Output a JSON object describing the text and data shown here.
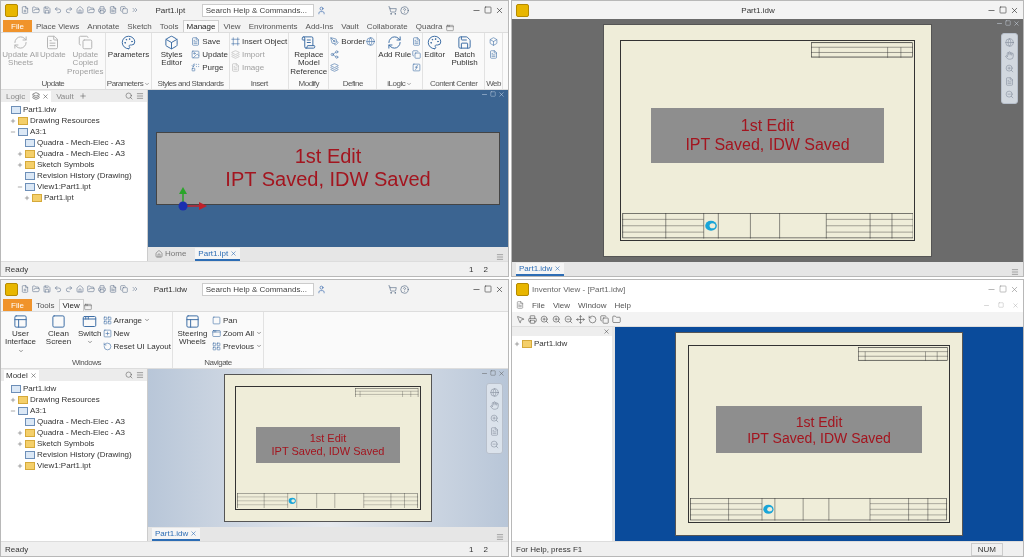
{
  "panes": [
    {
      "kind": "inventor",
      "title": "Part1.ipt",
      "search": {
        "placeholder": "Search Help & Commands..."
      },
      "ribbon_tabs": [
        {
          "label": "File",
          "selected": false
        },
        {
          "label": "Place Views",
          "selected": false
        },
        {
          "label": "Annotate",
          "selected": false
        },
        {
          "label": "Sketch",
          "selected": false
        },
        {
          "label": "Tools",
          "selected": false
        },
        {
          "label": "Manage",
          "selected": true
        },
        {
          "label": "View",
          "selected": false
        },
        {
          "label": "Environments",
          "selected": false
        },
        {
          "label": "Add-Ins",
          "selected": false
        },
        {
          "label": "Vault",
          "selected": false
        },
        {
          "label": "Collaborate",
          "selected": false
        },
        {
          "label": "Quadra",
          "selected": false
        }
      ],
      "panels": [
        {
          "title": "Update",
          "dropdown": false,
          "tools": [
            {
              "kind": "large",
              "label": "Update All Sheets",
              "disabled": true
            },
            {
              "kind": "large",
              "label": "Update",
              "disabled": true
            },
            {
              "kind": "large",
              "label": "Update Copied Properties",
              "disabled": true
            }
          ]
        },
        {
          "title": "Parameters",
          "dropdown": true,
          "tools": [
            {
              "kind": "large",
              "label": "Parameters",
              "disabled": false
            }
          ]
        },
        {
          "title": "Styles and Standards",
          "dropdown": false,
          "tools": [
            {
              "kind": "large",
              "label": "Styles Editor",
              "disabled": false
            },
            {
              "kind": "small",
              "label": "Save",
              "disabled": false
            },
            {
              "kind": "small",
              "label": "Update",
              "disabled": false
            },
            {
              "kind": "small",
              "label": "Purge",
              "disabled": false
            }
          ]
        },
        {
          "title": "Insert",
          "dropdown": false,
          "tools": [
            {
              "kind": "small",
              "label": "Insert Object",
              "disabled": false
            },
            {
              "kind": "small",
              "label": "Import",
              "disabled": true
            },
            {
              "kind": "small",
              "label": "Image",
              "disabled": true
            }
          ]
        },
        {
          "title": "Modify",
          "dropdown": false,
          "tools": [
            {
              "kind": "large",
              "label": "Replace Model Reference",
              "disabled": false
            }
          ]
        },
        {
          "title": "Define",
          "dropdown": false,
          "tools": [
            {
              "kind": "small",
              "label": "Border",
              "disabled": false
            },
            {
              "kind": "icon",
              "disabled": false
            },
            {
              "kind": "icon",
              "disabled": false
            },
            {
              "kind": "icon",
              "disabled": false
            }
          ]
        },
        {
          "title": "iLogic",
          "dropdown": true,
          "tools": [
            {
              "kind": "large",
              "label": "Add Rule",
              "disabled": false
            },
            {
              "kind": "icon",
              "disabled": false
            },
            {
              "kind": "icon",
              "disabled": false
            },
            {
              "kind": "icon",
              "disabled": false
            }
          ]
        },
        {
          "title": "Content Center",
          "dropdown": false,
          "tools": [
            {
              "kind": "large",
              "label": "Editor",
              "disabled": false
            },
            {
              "kind": "large",
              "label": "Batch Publish",
              "disabled": false
            }
          ]
        },
        {
          "title": "Web",
          "dropdown": false,
          "tools": [
            {
              "kind": "icon",
              "disabled": false
            },
            {
              "kind": "icon",
              "disabled": false
            }
          ]
        }
      ],
      "browser": {
        "tabs": [
          {
            "label": "Logic",
            "selected": false,
            "closable": false
          },
          {
            "selected": true,
            "closable": true
          },
          {
            "label": "Vault",
            "selected": false,
            "closable": false
          }
        ],
        "tree": [
          {
            "label": "Part1.idw",
            "children": [
              {
                "label": "Drawing Resources",
                "expanded": false
              },
              {
                "label": "A3:1",
                "expanded": true,
                "children": [
                  {
                    "label": "Quadra - Mech-Elec - A3"
                  },
                  {
                    "label": "Quadra - Mech-Elec - A3",
                    "expanded": false
                  },
                  {
                    "label": "Sketch Symbols",
                    "expanded": false
                  },
                  {
                    "label": "Revision History (Drawing)"
                  },
                  {
                    "label": "View1:Part1.ipt",
                    "expanded": true,
                    "children": [
                      {
                        "label": "Part1.ipt",
                        "expanded": false
                      }
                    ]
                  }
                ]
              }
            ]
          }
        ]
      },
      "viewport": {
        "kind": "model",
        "note": [
          "1st Edit",
          "IPT Saved, IDW Saved"
        ]
      },
      "doc_tabs": [
        {
          "label": "Home",
          "selected": false
        },
        {
          "label": "Part1.ipt",
          "selected": true
        }
      ],
      "status_bar": {
        "text": "Ready",
        "pages": [
          "1",
          "2"
        ]
      }
    },
    {
      "kind": "drawing_window",
      "title": "Part1.idw",
      "viewport": {
        "kind": "dark",
        "note": [
          "1st Edit",
          "IPT Saved, IDW Saved"
        ]
      },
      "doc_tabs": [
        {
          "label": "Part1.idw",
          "selected": true
        }
      ]
    },
    {
      "kind": "inventor",
      "title": "Part1.idw",
      "search": {
        "placeholder": "Search Help & Commands..."
      },
      "ribbon_tabs": [
        {
          "label": "File",
          "selected": false
        },
        {
          "label": "Tools",
          "selected": false
        },
        {
          "label": "View",
          "selected": true
        }
      ],
      "panels": [
        {
          "title": "Windows",
          "dropdown": false,
          "tools": [
            {
              "kind": "large",
              "label": "User Interface",
              "disabled": false,
              "dropdown": true
            },
            {
              "kind": "large",
              "label": "Clean Screen",
              "disabled": false
            },
            {
              "kind": "large",
              "label": "Switch",
              "disabled": false,
              "dropdown": true
            },
            {
              "kind": "small",
              "label": "Arrange",
              "disabled": false,
              "dropdown": true
            },
            {
              "kind": "small",
              "label": "New",
              "disabled": false
            },
            {
              "kind": "small",
              "label": "Reset UI Layout",
              "disabled": false
            }
          ]
        },
        {
          "title": "Navigate",
          "dropdown": false,
          "tools": [
            {
              "kind": "large",
              "label": "Steering Wheels",
              "disabled": false
            },
            {
              "kind": "small",
              "label": "Pan",
              "disabled": false
            },
            {
              "kind": "small",
              "label": "Zoom All",
              "disabled": false,
              "dropdown": true
            },
            {
              "kind": "small",
              "label": "Previous",
              "disabled": false,
              "dropdown": true
            }
          ]
        }
      ],
      "browser": {
        "tabs": [
          {
            "label": "Model",
            "selected": true,
            "closable": true
          }
        ],
        "tree": [
          {
            "label": "Part1.idw",
            "children": [
              {
                "label": "Drawing Resources",
                "expanded": false
              },
              {
                "label": "A3:1",
                "expanded": true,
                "children": [
                  {
                    "label": "Quadra - Mech-Elec - A3"
                  },
                  {
                    "label": "Quadra - Mech-Elec - A3",
                    "expanded": false
                  },
                  {
                    "label": "Sketch Symbols",
                    "expanded": false
                  },
                  {
                    "label": "Revision History (Drawing)"
                  },
                  {
                    "label": "View1:Part1.ipt",
                    "expanded": false
                  }
                ]
              }
            ]
          }
        ]
      },
      "viewport": {
        "kind": "sheet",
        "note": [
          "1st Edit",
          "IPT Saved, IDW Saved"
        ]
      },
      "doc_tabs": [
        {
          "label": "Part1.idw",
          "selected": true
        }
      ],
      "status_bar": {
        "text": "Ready",
        "pages": [
          "1",
          "2"
        ]
      }
    },
    {
      "kind": "viewer",
      "title": "Inventor View - [Part1.idw]",
      "menu": [
        "File",
        "View",
        "Window",
        "Help"
      ],
      "tree": [
        {
          "label": "Part1.idw",
          "expanded": false
        }
      ],
      "viewport": {
        "kind": "blue",
        "note": [
          "1st Edit",
          "IPT Saved, IDW Saved"
        ]
      },
      "status_bar": {
        "text": "For Help, press F1",
        "indicators": [
          "NUM"
        ]
      }
    }
  ]
}
